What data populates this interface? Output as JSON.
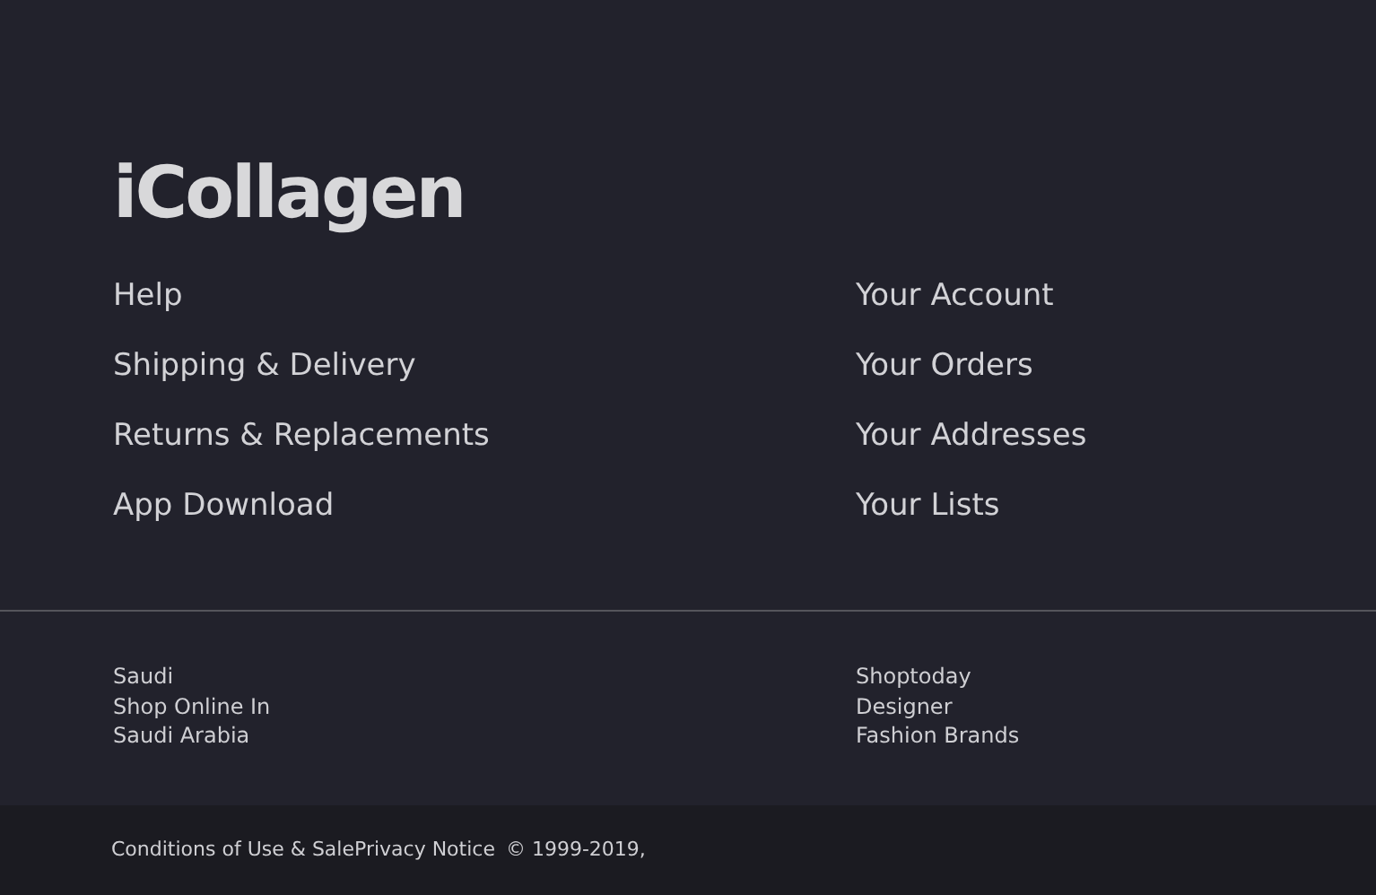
{
  "logo": "iCollagen",
  "link_columns": [
    [
      "Help",
      "Shipping & Delivery",
      "Returns & Replacements",
      "App Download"
    ],
    [
      "Your Account",
      "Your Orders",
      "Your Addresses",
      "Your Lists"
    ]
  ],
  "promos": [
    [
      "Saudi",
      "Shop Online In",
      "Saudi Arabia"
    ],
    [
      "Shoptoday",
      "Designer",
      "Fashion Brands"
    ]
  ],
  "legal": [
    {
      "kind": "link",
      "text": "Conditions of Use & Sale"
    },
    {
      "kind": "link",
      "text": "Privacy Notice"
    },
    {
      "kind": "text",
      "text": "© 1999-2019,"
    }
  ]
}
